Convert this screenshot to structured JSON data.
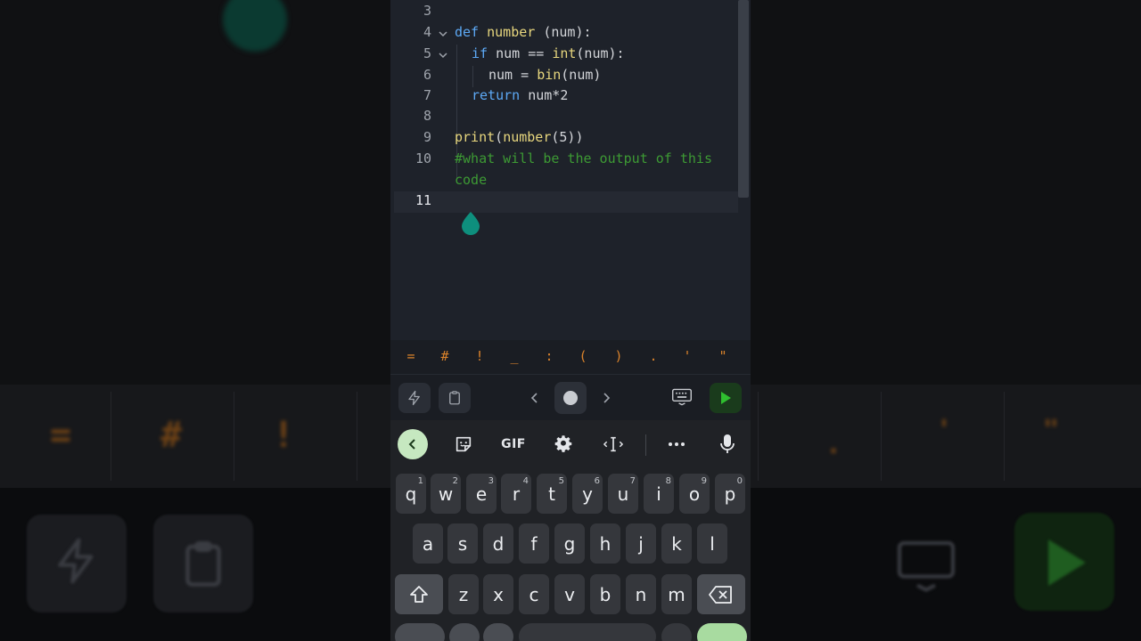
{
  "editor": {
    "lines": [
      {
        "num": "3",
        "code": ""
      },
      {
        "num": "4",
        "kw": "def ",
        "fn": "number",
        "rest": " (num):"
      },
      {
        "num": "5",
        "kw": "if ",
        "rest": "num == ",
        "fn": "int",
        "rest2": "(num):"
      },
      {
        "num": "6",
        "rest": "num = ",
        "fn": "bin",
        "rest2": "(num)"
      },
      {
        "num": "7",
        "kw": "return ",
        "rest": "num*2"
      },
      {
        "num": "8",
        "code": ""
      },
      {
        "num": "9",
        "fn": "print",
        "rest": "(",
        "fn2": "number",
        "rest2": "(5))"
      },
      {
        "num": "10",
        "comment": "#what will be the output of this"
      },
      {
        "num": "",
        "comment": "code"
      },
      {
        "num": "11",
        "code": ""
      }
    ]
  },
  "symbols": [
    "=",
    "#",
    "!",
    "_",
    ":",
    "(",
    ")",
    ".",
    "'",
    "\""
  ],
  "toolbar": {
    "icons": [
      "lightning-icon",
      "clipboard-icon",
      "chevron-left-icon",
      "home-dot",
      "chevron-right-icon",
      "keyboard-icon",
      "run-icon"
    ],
    "run_color": "#2fbf2f"
  },
  "keyboard": {
    "strip": {
      "gif_label": "GIF"
    },
    "row1": [
      {
        "k": "q",
        "h": "1"
      },
      {
        "k": "w",
        "h": "2"
      },
      {
        "k": "e",
        "h": "3"
      },
      {
        "k": "r",
        "h": "4"
      },
      {
        "k": "t",
        "h": "5"
      },
      {
        "k": "y",
        "h": "6"
      },
      {
        "k": "u",
        "h": "7"
      },
      {
        "k": "i",
        "h": "8"
      },
      {
        "k": "o",
        "h": "9"
      },
      {
        "k": "p",
        "h": "0"
      }
    ],
    "row2": [
      "a",
      "s",
      "d",
      "f",
      "g",
      "h",
      "j",
      "k",
      "l"
    ],
    "row3": [
      "z",
      "x",
      "c",
      "v",
      "b",
      "n",
      "m"
    ]
  },
  "colors": {
    "accent_teal": "#0e8f7d",
    "symbol_orange": "#d9822b",
    "keyword_blue": "#5da9f5",
    "function_yellow": "#e8d77e",
    "comment_green": "#3d9a34"
  }
}
